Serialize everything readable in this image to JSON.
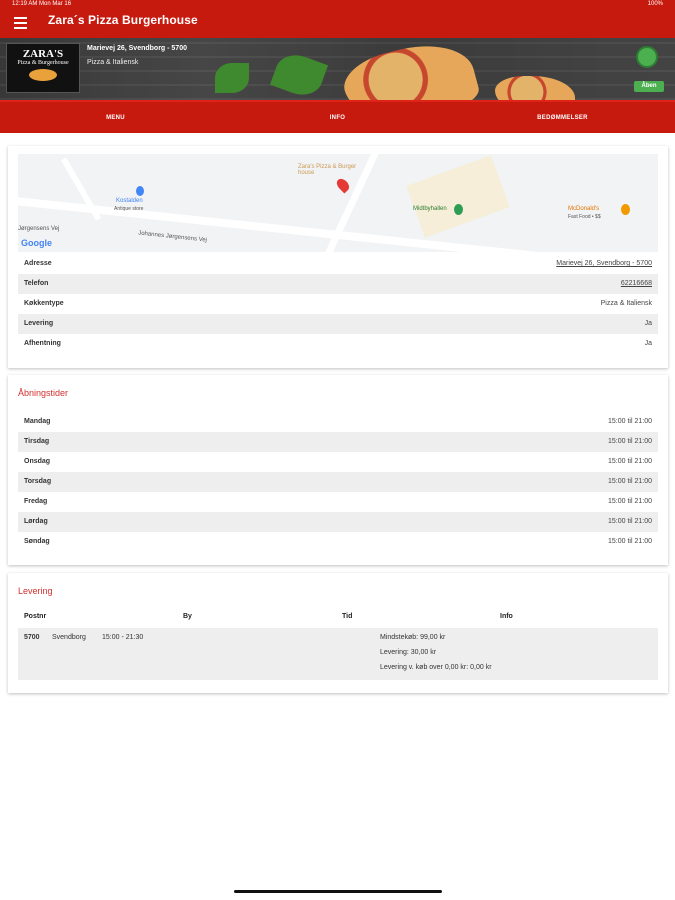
{
  "status": {
    "time": "12:19 AM   Mon Mar 16",
    "right": "100%"
  },
  "appbar": {
    "title": "Zara´s Pizza Burgerhouse"
  },
  "restaurant": {
    "logo_line1": "ZARA'S",
    "logo_line2": "Pizza & Burgerhouse",
    "address": "Marievej 26, Svendborg - 5700",
    "cuisine": "Pizza & Italiensk",
    "status_badge": "Åben",
    "colors": {
      "brand": "#c71a0f",
      "open": "#4caf50"
    }
  },
  "tabs": [
    {
      "label": "MENU"
    },
    {
      "label": "INFO",
      "active": true
    },
    {
      "label": "BEDØMMELSER"
    }
  ],
  "map": {
    "labels": [
      "Zara's Pizza & Burger house",
      "Kostalden",
      "Antique store",
      "Midtbyhallen",
      "McDonald's",
      "Fast Food • $$",
      "Johannes Jørgensens Vej",
      "Jørgensens Vej",
      "Google"
    ]
  },
  "info": {
    "rows": [
      {
        "key": "Adresse",
        "value": "Marievej 26, Svendborg - 5700"
      },
      {
        "key": "Telefon",
        "value": "62216668"
      },
      {
        "key": "Køkkentype",
        "value": "Pizza & Italiensk"
      },
      {
        "key": "Levering",
        "value": "Ja"
      },
      {
        "key": "Afhentning",
        "value": "Ja"
      }
    ]
  },
  "hours": {
    "title": "Åbningstider",
    "rows": [
      {
        "day": "Mandag",
        "time": "15:00 til 21:00"
      },
      {
        "day": "Tirsdag",
        "time": "15:00 til 21:00"
      },
      {
        "day": "Onsdag",
        "time": "15:00 til 21:00"
      },
      {
        "day": "Torsdag",
        "time": "15:00 til 21:00"
      },
      {
        "day": "Fredag",
        "time": "15:00 til 21:00"
      },
      {
        "day": "Lørdag",
        "time": "15:00 til 21:00"
      },
      {
        "day": "Søndag",
        "time": "15:00 til 21:00"
      }
    ]
  },
  "delivery": {
    "title": "Levering",
    "headers": {
      "postnr": "Postnr",
      "by": "By",
      "tid": "Tid",
      "info": "Info"
    },
    "row": {
      "postnr": "5700",
      "by": "Svendborg",
      "tid": "15:00 - 21:30",
      "info1": "Mindstekøb: 99,00 kr",
      "info2": "Levering: 30,00 kr",
      "info3": "Levering v. køb over 0,00 kr: 0,00 kr"
    }
  }
}
